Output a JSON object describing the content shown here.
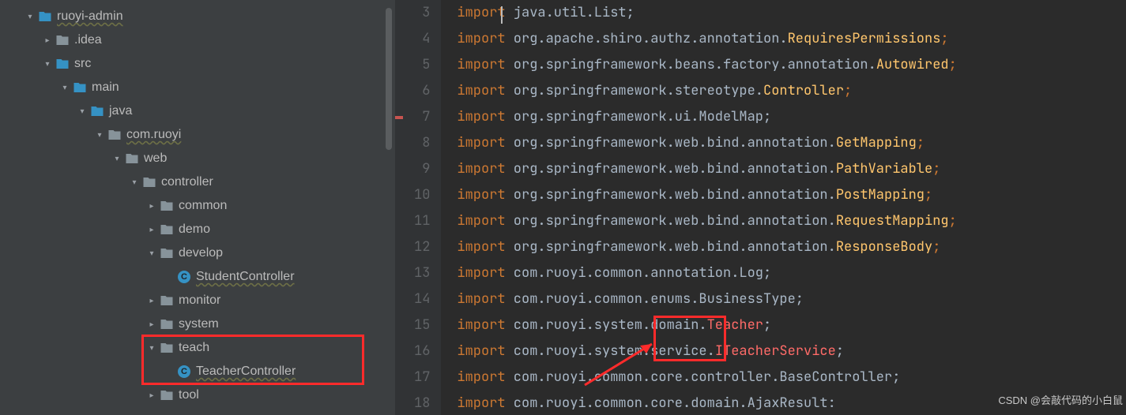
{
  "tree": [
    {
      "indent": 30,
      "arrow": "down",
      "icon": "folder-blue",
      "label": "ruoyi-admin",
      "squiggle": true
    },
    {
      "indent": 52,
      "arrow": "right",
      "icon": "folder",
      "label": ".idea"
    },
    {
      "indent": 52,
      "arrow": "down",
      "icon": "folder-blue",
      "label": "src"
    },
    {
      "indent": 74,
      "arrow": "down",
      "icon": "folder-blue",
      "label": "main"
    },
    {
      "indent": 96,
      "arrow": "down",
      "icon": "folder-blue",
      "label": "java"
    },
    {
      "indent": 118,
      "arrow": "down",
      "icon": "folder",
      "label": "com.ruoyi",
      "squiggle": true
    },
    {
      "indent": 140,
      "arrow": "down",
      "icon": "folder",
      "label": "web"
    },
    {
      "indent": 162,
      "arrow": "down",
      "icon": "folder",
      "label": "controller"
    },
    {
      "indent": 184,
      "arrow": "right",
      "icon": "folder",
      "label": "common"
    },
    {
      "indent": 184,
      "arrow": "right",
      "icon": "folder",
      "label": "demo"
    },
    {
      "indent": 184,
      "arrow": "down",
      "icon": "folder",
      "label": "develop"
    },
    {
      "indent": 206,
      "arrow": "",
      "icon": "class",
      "label": "StudentController",
      "squiggle": true
    },
    {
      "indent": 184,
      "arrow": "right",
      "icon": "folder",
      "label": "monitor"
    },
    {
      "indent": 184,
      "arrow": "right",
      "icon": "folder",
      "label": "system"
    },
    {
      "indent": 184,
      "arrow": "down",
      "icon": "folder",
      "label": "teach",
      "hl": true
    },
    {
      "indent": 206,
      "arrow": "",
      "icon": "class",
      "label": "TeacherController",
      "squiggle": true,
      "hl": true
    },
    {
      "indent": 184,
      "arrow": "right",
      "icon": "folder",
      "label": "tool"
    }
  ],
  "classIconLetter": "C",
  "editor": {
    "startLine": 3,
    "lines": [
      [
        {
          "t": "import",
          "c": "kw"
        },
        {
          "t": " java.util.List;",
          "c": "plain"
        }
      ],
      [
        {
          "t": "import",
          "c": "kw"
        },
        {
          "t": " org.apache.shiro.authz.annotation.",
          "c": "plain"
        },
        {
          "t": "RequiresPermissions",
          "c": "class"
        },
        {
          "t": ";",
          "c": "semi"
        }
      ],
      [
        {
          "t": "import",
          "c": "kw"
        },
        {
          "t": " org.springframework.beans.factory.annotation.",
          "c": "plain"
        },
        {
          "t": "Autowired",
          "c": "class"
        },
        {
          "t": ";",
          "c": "semi"
        }
      ],
      [
        {
          "t": "import",
          "c": "kw"
        },
        {
          "t": " org.springframework.stereotype.",
          "c": "plain"
        },
        {
          "t": "Controller",
          "c": "class"
        },
        {
          "t": ";",
          "c": "semi"
        }
      ],
      [
        {
          "t": "import",
          "c": "kw"
        },
        {
          "t": " org.springframework.ui.ModelMap;",
          "c": "plain"
        }
      ],
      [
        {
          "t": "import",
          "c": "kw"
        },
        {
          "t": " org.springframework.web.bind.annotation.",
          "c": "plain"
        },
        {
          "t": "GetMapping",
          "c": "class"
        },
        {
          "t": ";",
          "c": "semi"
        }
      ],
      [
        {
          "t": "import",
          "c": "kw"
        },
        {
          "t": " org.springframework.web.bind.annotation.",
          "c": "plain"
        },
        {
          "t": "PathVariable",
          "c": "class"
        },
        {
          "t": ";",
          "c": "semi"
        }
      ],
      [
        {
          "t": "import",
          "c": "kw"
        },
        {
          "t": " org.springframework.web.bind.annotation.",
          "c": "plain"
        },
        {
          "t": "PostMapping",
          "c": "class"
        },
        {
          "t": ";",
          "c": "semi"
        }
      ],
      [
        {
          "t": "import",
          "c": "kw"
        },
        {
          "t": " org.springframework.web.bind.annotation.",
          "c": "plain"
        },
        {
          "t": "RequestMapping",
          "c": "class"
        },
        {
          "t": ";",
          "c": "semi"
        }
      ],
      [
        {
          "t": "import",
          "c": "kw"
        },
        {
          "t": " org.springframework.web.bind.annotation.",
          "c": "plain"
        },
        {
          "t": "ResponseBody",
          "c": "class"
        },
        {
          "t": ";",
          "c": "semi"
        }
      ],
      [
        {
          "t": "import",
          "c": "kw"
        },
        {
          "t": " com.ruoyi.common.annotation.Log;",
          "c": "plain"
        }
      ],
      [
        {
          "t": "import",
          "c": "kw"
        },
        {
          "t": " com.ruoyi.common.enums.BusinessType;",
          "c": "plain"
        }
      ],
      [
        {
          "t": "import",
          "c": "kw"
        },
        {
          "t": " com.ruoyi.system.domain.",
          "c": "plain"
        },
        {
          "t": "Teacher",
          "c": "err"
        },
        {
          "t": ";",
          "c": "plain"
        }
      ],
      [
        {
          "t": "import",
          "c": "kw"
        },
        {
          "t": " com.ruoyi.system.service.",
          "c": "plain"
        },
        {
          "t": "ITeacherService",
          "c": "err"
        },
        {
          "t": ";",
          "c": "plain"
        }
      ],
      [
        {
          "t": "import",
          "c": "kw"
        },
        {
          "t": " com.ruoyi.common.core.controller.BaseController;",
          "c": "plain"
        }
      ],
      [
        {
          "t": "import",
          "c": "kw"
        },
        {
          "t": " com.ruoyi.common.core.domain.AjaxResult:",
          "c": "plain"
        }
      ]
    ]
  },
  "watermark": "CSDN @会敲代码的小白鼠"
}
